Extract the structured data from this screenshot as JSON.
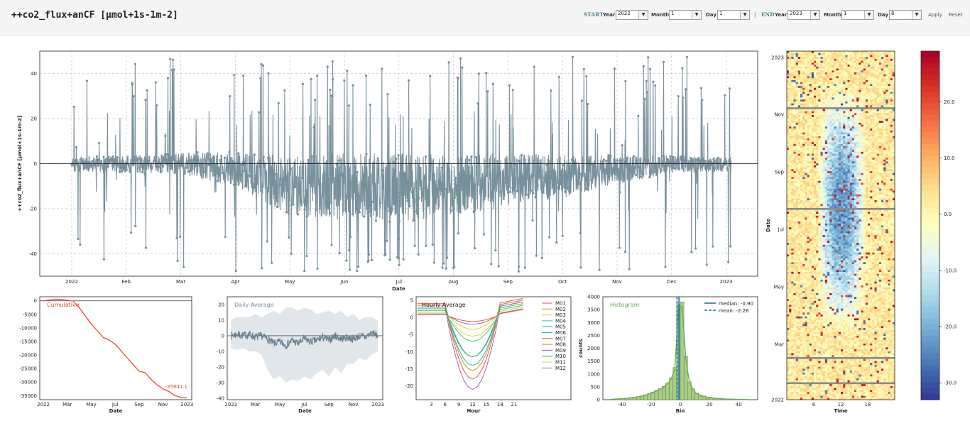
{
  "page": {
    "title": "++co2_flux+anCF [µmol+1s-1m-2]"
  },
  "controls": {
    "start_label": "START",
    "end_label": "END",
    "year_label": "Year",
    "month_label": "Month",
    "day_label": "Day",
    "separator": "|",
    "start": {
      "year": "2022",
      "month": "1",
      "day": "1"
    },
    "end": {
      "year": "2023",
      "month": "1",
      "day": "8"
    },
    "apply_label": "Apply",
    "reset_label": "Reset"
  },
  "chart_data": [
    {
      "id": "timeseries",
      "type": "line",
      "xlabel": "Date",
      "ylabel": "++co2_flux+anCF  [µmol+1s-1m-2]",
      "ylim": [
        -50,
        50
      ],
      "x_tick_labels": [
        "2022",
        "Feb",
        "Mar",
        "Apr",
        "May",
        "Jun",
        "Jul",
        "Aug",
        "Sep",
        "Oct",
        "Nov",
        "Dec",
        "2023"
      ],
      "y_ticks": [
        40,
        20,
        0,
        -20,
        -40
      ],
      "grid": true,
      "color": "#78909c",
      "description_envelope": {
        "month_index": [
          0,
          1,
          2,
          3,
          4,
          5,
          6,
          7,
          8,
          9,
          10,
          11,
          12
        ],
        "typical_low": [
          -5,
          -6,
          -7,
          -14,
          -30,
          -32,
          -33,
          -30,
          -25,
          -20,
          -12,
          -6,
          -5
        ],
        "typical_high": [
          5,
          6,
          8,
          10,
          12,
          14,
          14,
          13,
          12,
          10,
          8,
          6,
          5
        ]
      }
    },
    {
      "id": "cumulative",
      "type": "line",
      "title": "Cumulative",
      "xlabel": "Date",
      "x_tick_labels": [
        "2022",
        "Mar",
        "May",
        "Jul",
        "Sep",
        "Nov",
        "2023"
      ],
      "y_ticks": [
        0,
        -5000,
        -10000,
        -15000,
        -20000,
        -25000,
        -30000,
        -35000
      ],
      "ylim": [
        -36500,
        1500
      ],
      "color": "#e74c3c",
      "annotation": "-35841.1",
      "x_month": [
        0,
        0.5,
        1,
        1.5,
        2,
        2.5,
        3,
        3.5,
        4,
        4.5,
        5,
        5.5,
        6,
        6.5,
        7,
        7.5,
        8,
        8.5,
        9,
        9.5,
        10,
        10.5,
        11,
        11.5,
        12
      ],
      "values": [
        0,
        300,
        600,
        500,
        200,
        -100,
        -2500,
        -5500,
        -8500,
        -11000,
        -13500,
        -14500,
        -16000,
        -18500,
        -21000,
        -23500,
        -26000,
        -26500,
        -29000,
        -31000,
        -32500,
        -33500,
        -35000,
        -35600,
        -35841
      ]
    },
    {
      "id": "daily",
      "type": "line",
      "title": "Daily Average",
      "xlabel": "Date",
      "x_tick_labels": [
        "2022",
        "Mar",
        "May",
        "Jul",
        "Sep",
        "Nov",
        "2023"
      ],
      "y_ticks": [
        20,
        10,
        0,
        -10,
        -20,
        -30,
        -40
      ],
      "ylim": [
        -41,
        25
      ],
      "color": "#6a8290",
      "band_color": "#dde3e8",
      "x_month": [
        0,
        0.5,
        1,
        1.5,
        2,
        2.5,
        3,
        3.5,
        4,
        4.5,
        5,
        5.5,
        6,
        6.5,
        7,
        7.5,
        8,
        8.5,
        9,
        9.5,
        10,
        10.5,
        11,
        11.5,
        12
      ],
      "values": [
        0,
        1,
        0,
        1,
        -1,
        0,
        -2,
        -5,
        -4,
        -6,
        -3,
        -5,
        -2,
        -4,
        -3,
        -1,
        -3,
        0,
        -2,
        -1,
        -2,
        0,
        -1,
        2,
        0
      ],
      "band_low": [
        -8,
        -9,
        -8,
        -10,
        -10,
        -12,
        -22,
        -28,
        -26,
        -30,
        -28,
        -29,
        -26,
        -28,
        -24,
        -22,
        -26,
        -20,
        -24,
        -18,
        -18,
        -14,
        -16,
        -12,
        -10
      ],
      "band_high": [
        10,
        12,
        12,
        12,
        14,
        12,
        14,
        16,
        14,
        18,
        18,
        16,
        18,
        17,
        14,
        15,
        16,
        14,
        16,
        12,
        14,
        10,
        12,
        12,
        10
      ]
    },
    {
      "id": "hourly",
      "type": "line",
      "title": "Hourly Average",
      "xlabel": "Hour",
      "x_ticks": [
        3,
        6,
        9,
        12,
        15,
        18,
        21
      ],
      "y_ticks": [
        5,
        0,
        -5,
        -10,
        -15,
        -20
      ],
      "ylim": [
        -24,
        6
      ],
      "x_hours": [
        0,
        1,
        2,
        3,
        4,
        5,
        6,
        7,
        8,
        9,
        10,
        11,
        12,
        13,
        14,
        15,
        16,
        17,
        18,
        19,
        20,
        21,
        22,
        23
      ],
      "series": [
        {
          "name": "M01",
          "color": "#e74c3c",
          "amp": 2,
          "base": 0.8
        },
        {
          "name": "M02",
          "color": "#e67e22",
          "amp": 3,
          "base": 1.0
        },
        {
          "name": "M03",
          "color": "#f1c40f",
          "amp": 5,
          "base": 1.5
        },
        {
          "name": "M04",
          "color": "#2ecc71",
          "amp": 9,
          "base": 2.0
        },
        {
          "name": "M05",
          "color": "#1abc9c",
          "amp": 17,
          "base": 3.0
        },
        {
          "name": "M06",
          "color": "#3498db",
          "amp": 15,
          "base": 3.5
        },
        {
          "name": "M07",
          "color": "#e74c3c",
          "amp": 22,
          "base": 4.0
        },
        {
          "name": "M08",
          "color": "#e67e22",
          "amp": 19,
          "base": 3.5
        },
        {
          "name": "M09",
          "color": "#9b59b6",
          "amp": 24,
          "base": 3.0
        },
        {
          "name": "M10",
          "color": "#27ae60",
          "amp": 14,
          "base": 2.5
        },
        {
          "name": "M11",
          "color": "#cddc39",
          "amp": 7,
          "base": 1.5
        },
        {
          "name": "M12",
          "color": "#8e7cc3",
          "amp": 3,
          "base": 1.0
        }
      ]
    },
    {
      "id": "histogram",
      "type": "bar",
      "title": "Histogram",
      "xlabel": "Bin",
      "ylabel": "counts",
      "x_ticks": [
        -40,
        -20,
        0,
        20,
        40
      ],
      "y_ticks": [
        0,
        500,
        1000,
        1500,
        2000,
        2500,
        3000,
        3500,
        4000
      ],
      "ylim": [
        0,
        4000
      ],
      "xlim": [
        -53,
        53
      ],
      "bin_width": 2.5,
      "bin_starts": [
        -47.5,
        -45,
        -42.5,
        -40,
        -37.5,
        -35,
        -32.5,
        -30,
        -27.5,
        -25,
        -22.5,
        -20,
        -17.5,
        -15,
        -12.5,
        -10,
        -7.5,
        -5,
        -2.5,
        0,
        2.5,
        5,
        7.5,
        10,
        12.5,
        15,
        17.5,
        20,
        22.5,
        25,
        27.5,
        30,
        32.5,
        35,
        37.5,
        40,
        42.5,
        45
      ],
      "counts": [
        20,
        30,
        40,
        50,
        60,
        80,
        100,
        120,
        150,
        190,
        240,
        300,
        360,
        430,
        520,
        650,
        850,
        1250,
        3700,
        3800,
        1700,
        700,
        420,
        250,
        180,
        140,
        100,
        80,
        60,
        50,
        40,
        30,
        25,
        20,
        15,
        10,
        8,
        5
      ],
      "bar_color": "#a8cf84",
      "kde_color": "#6aa84f",
      "median": -0.9,
      "mean": -2.26,
      "legend": [
        "median: -0.90",
        "mean: -2.26"
      ],
      "line_color": "#1f6fa0"
    },
    {
      "id": "heatmap",
      "type": "heatmap",
      "xlabel": "Time",
      "ylabel": "Date",
      "x_ticks": [
        6,
        12,
        18
      ],
      "y_tick_labels": [
        "2023",
        "Nov",
        "Sep",
        "Jul",
        "May",
        "Mar",
        "2022"
      ],
      "colorbar_ticks": [
        20.0,
        10.0,
        0.0,
        -10.0,
        -20.0,
        -30.0
      ],
      "colorbar_tick_labels": [
        "20.0",
        "10.0",
        "0.0",
        "-10.0",
        "-20.0",
        "-30.0"
      ],
      "zlim": [
        -33,
        29
      ],
      "colormap": "RdYlBu_r"
    }
  ]
}
